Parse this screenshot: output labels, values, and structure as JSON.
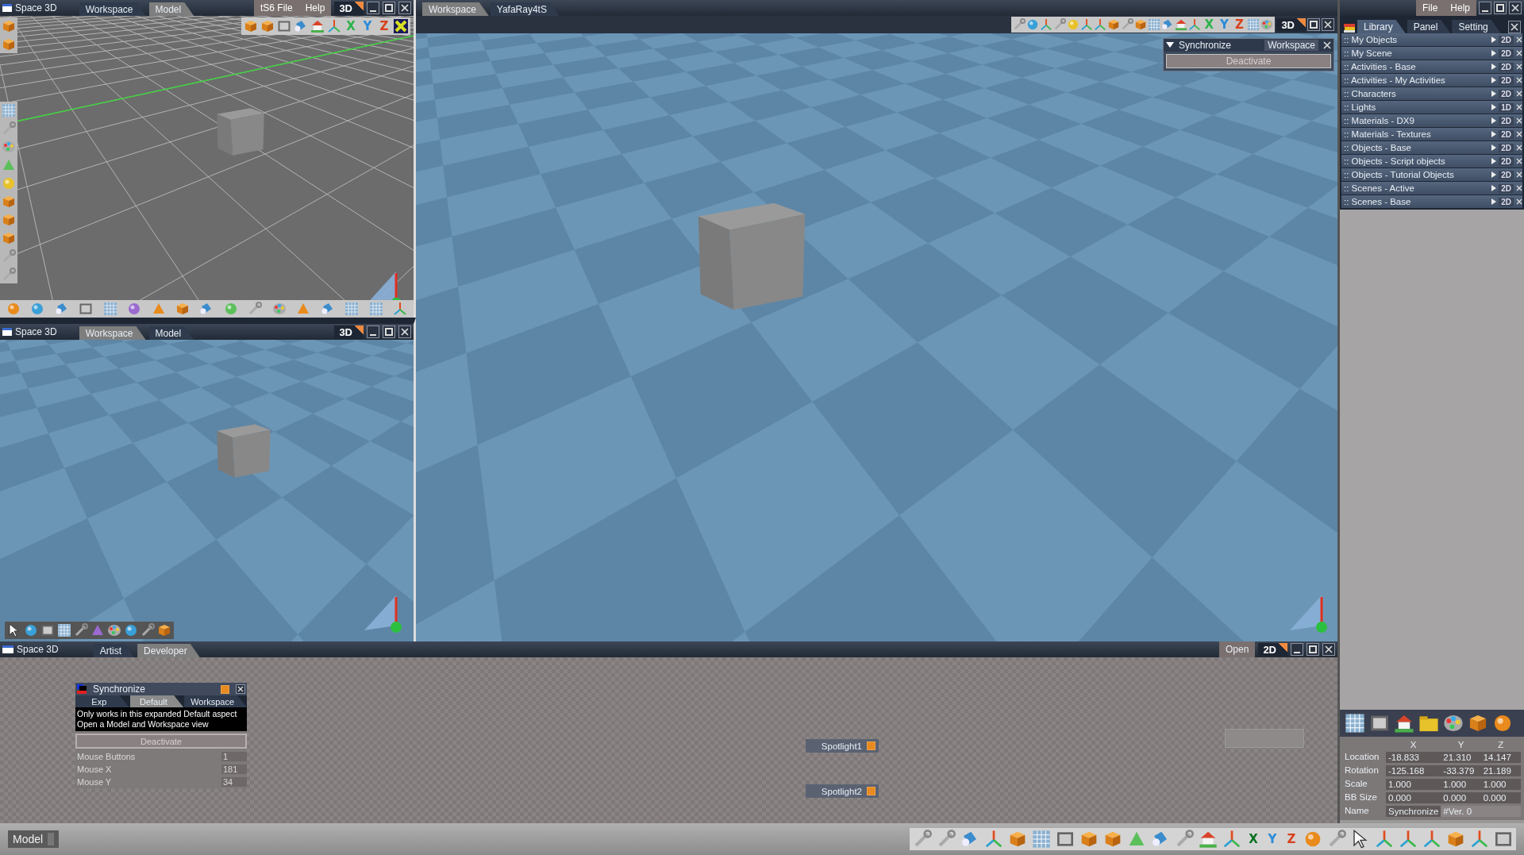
{
  "top_left_view": {
    "title": "Space 3D",
    "tabs": [
      {
        "label": "Workspace",
        "selected": false
      },
      {
        "label": "Model",
        "selected": true
      }
    ],
    "menu": [
      "tS6 File",
      "Help"
    ],
    "mode": "3D",
    "axis_buttons": [
      "X",
      "Y",
      "Z"
    ]
  },
  "bottom_left_view": {
    "title": "Space 3D",
    "tabs": [
      {
        "label": "Workspace",
        "selected": true
      },
      {
        "label": "Model",
        "selected": false
      }
    ],
    "mode": "3D"
  },
  "main_view": {
    "tabs": [
      {
        "label": "Workspace",
        "selected": true
      },
      {
        "label": "YafaRay4tS",
        "selected": false
      }
    ],
    "axis_buttons": [
      "X",
      "Y",
      "Z"
    ],
    "mode": "3D",
    "sync_panel": {
      "title": "Synchronize",
      "aspect": "Workspace",
      "button": "Deactivate"
    }
  },
  "library": {
    "menu": [
      "File",
      "Help"
    ],
    "tabs": [
      {
        "label": "Library",
        "selected": true
      },
      {
        "label": "Panel",
        "selected": false
      },
      {
        "label": "Setting",
        "selected": false
      }
    ],
    "items": [
      {
        "label": ":: My Objects",
        "mode": "2D"
      },
      {
        "label": ":: My Scene",
        "mode": "2D"
      },
      {
        "label": ":: Activities - Base",
        "mode": "2D"
      },
      {
        "label": ":: Activities - My Activities",
        "mode": "2D"
      },
      {
        "label": ":: Characters",
        "mode": "2D"
      },
      {
        "label": ":: Lights",
        "mode": "1D"
      },
      {
        "label": ":: Materials - DX9",
        "mode": "2D"
      },
      {
        "label": ":: Materials - Textures",
        "mode": "2D"
      },
      {
        "label": ":: Objects - Base",
        "mode": "2D"
      },
      {
        "label": ":: Objects - Script objects",
        "mode": "2D"
      },
      {
        "label": ":: Objects - Tutorial Objects",
        "mode": "2D"
      },
      {
        "label": ":: Scenes - Active",
        "mode": "2D"
      },
      {
        "label": ":: Scenes - Base",
        "mode": "2D"
      }
    ]
  },
  "properties": {
    "columns": [
      "X",
      "Y",
      "Z"
    ],
    "rows": [
      {
        "label": "Location",
        "values": [
          "-18.833",
          "21.310",
          "14.147"
        ]
      },
      {
        "label": "Rotation",
        "values": [
          "-125.168",
          "-33.379",
          "21.189"
        ]
      },
      {
        "label": "Scale",
        "values": [
          "1.000",
          "1.000",
          "1.000"
        ]
      },
      {
        "label": "BB Size",
        "values": [
          "0.000",
          "0.000",
          "0.000"
        ]
      }
    ],
    "name_label": "Name",
    "name": "Synchronize",
    "version": "#Ver. 0"
  },
  "schematic": {
    "title": "Space 3D",
    "tabs": [
      {
        "label": "Artist",
        "selected": false
      },
      {
        "label": "Developer",
        "selected": true
      }
    ],
    "open_button": "Open",
    "mode": "2D",
    "sync_node": {
      "title": "Synchronize",
      "tabs": [
        {
          "label": "Exp",
          "selected": false
        },
        {
          "label": "Default",
          "selected": true
        },
        {
          "label": "Workspace",
          "selected": false
        }
      ],
      "message": [
        "Only works in this expanded Default aspect",
        "Open a Model and Workspace view"
      ],
      "button": "Deactivate",
      "params": [
        {
          "label": "Mouse Buttons",
          "value": "1"
        },
        {
          "label": "Mouse X",
          "value": "181"
        },
        {
          "label": "Mouse Y",
          "value": "34"
        }
      ]
    },
    "nodes": [
      {
        "label": "Spotlight1"
      },
      {
        "label": "Spotlight2"
      }
    ]
  },
  "status_bar": {
    "field": "Model",
    "axis_buttons": [
      "X",
      "Y",
      "Z"
    ]
  }
}
